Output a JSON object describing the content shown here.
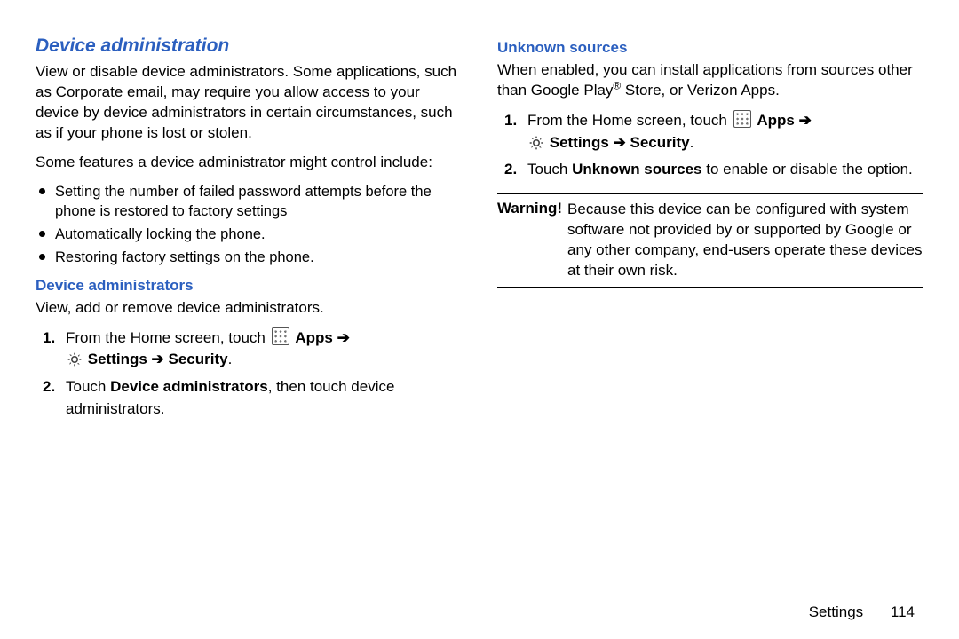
{
  "left": {
    "heading": "Device administration",
    "intro": "View or disable device administrators. Some applications, such as Corporate email, may require you allow access to your device by device administrators in certain circumstances, such as if your phone is lost or stolen.",
    "features_lead": "Some features a device administrator might control include:",
    "bullets": [
      "Setting the number of failed password attempts before the phone is restored to factory settings",
      "Automatically locking the phone.",
      "Restoring factory settings on the phone."
    ],
    "sub_heading": "Device administrators",
    "sub_intro": "View, add or remove device administrators.",
    "step1_lead": "From the Home screen, touch ",
    "apps_label": "Apps",
    "arrow": "➔",
    "settings_label": "Settings",
    "security_label": "Security",
    "period": ".",
    "step2_pre": "Touch ",
    "step2_bold": "Device administrators",
    "step2_post": ", then touch device administrators."
  },
  "right": {
    "heading": "Unknown sources",
    "intro_pre": "When enabled, you can install applications from sources other than Google Play",
    "reg": "®",
    "intro_post": " Store, or Verizon Apps.",
    "step1_lead": "From the Home screen, touch ",
    "apps_label": "Apps",
    "arrow": "➔",
    "settings_label": "Settings",
    "security_label": "Security",
    "period": ".",
    "step2_pre": "Touch ",
    "step2_bold": "Unknown sources",
    "step2_post": " to enable or disable the option.",
    "warning_label": "Warning!",
    "warning_text": "Because this device can be configured with system software not provided by or supported by Google or any other company, end-users operate these devices at their own risk."
  },
  "footer": {
    "section": "Settings",
    "page": "114"
  }
}
